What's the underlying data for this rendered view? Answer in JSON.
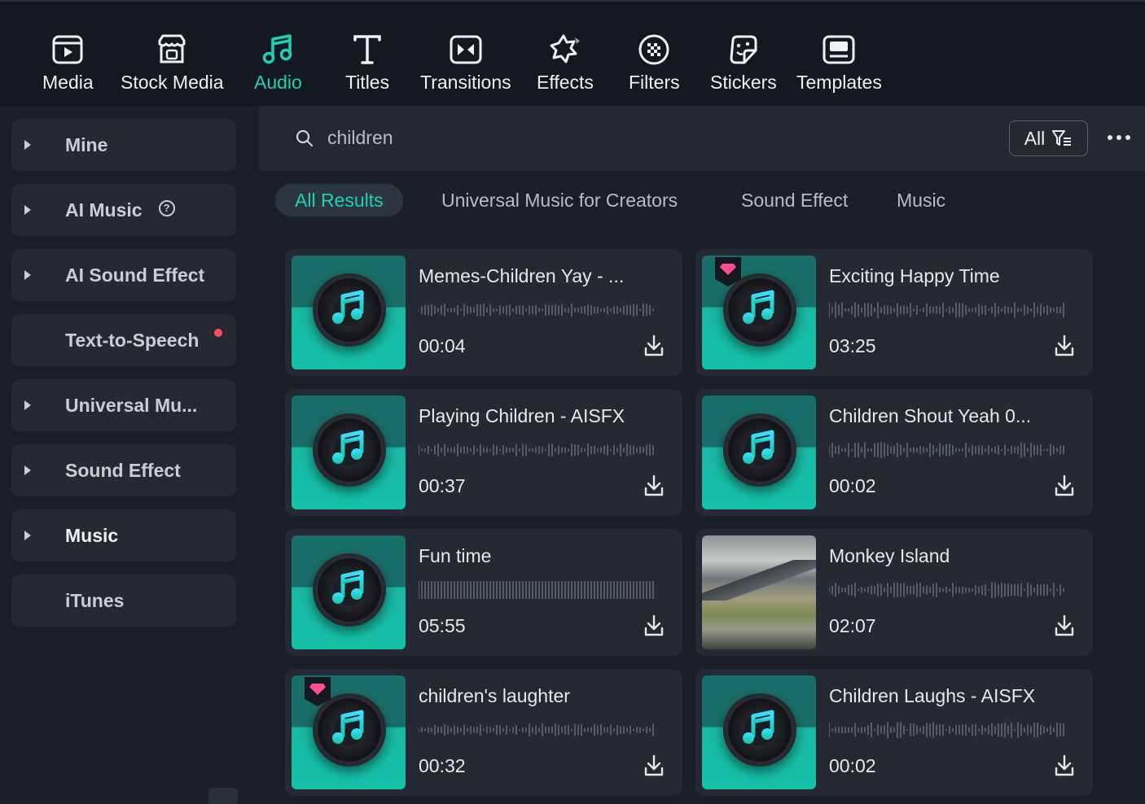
{
  "toolbar": {
    "items": [
      {
        "label": "Media",
        "icon": "media-icon"
      },
      {
        "label": "Stock Media",
        "icon": "stock-media-icon"
      },
      {
        "label": "Audio",
        "icon": "audio-icon",
        "active": true
      },
      {
        "label": "Titles",
        "icon": "titles-icon"
      },
      {
        "label": "Transitions",
        "icon": "transitions-icon"
      },
      {
        "label": "Effects",
        "icon": "effects-icon"
      },
      {
        "label": "Filters",
        "icon": "filters-icon"
      },
      {
        "label": "Stickers",
        "icon": "stickers-icon"
      },
      {
        "label": "Templates",
        "icon": "templates-icon"
      }
    ]
  },
  "sidebar": {
    "items": [
      {
        "label": "Mine"
      },
      {
        "label": "AI Music",
        "help": "?"
      },
      {
        "label": "AI Sound Effect"
      },
      {
        "label": "Text-to-Speech"
      },
      {
        "label": "Universal Mu..."
      },
      {
        "label": "Sound Effect"
      },
      {
        "label": "Music"
      },
      {
        "label": "iTunes"
      }
    ]
  },
  "search": {
    "query": "children",
    "filter_label": "All"
  },
  "tabs": [
    {
      "label": "All Results",
      "active": true
    },
    {
      "label": "Universal Music for Creators"
    },
    {
      "label": "Sound Effect"
    },
    {
      "label": "Music"
    }
  ],
  "results": [
    {
      "title": "Memes-Children Yay - ...",
      "duration": "00:04",
      "premium": false,
      "thumb": "music-disc"
    },
    {
      "title": "Exciting Happy Time",
      "duration": "03:25",
      "premium": true,
      "thumb": "music-disc"
    },
    {
      "title": "Playing Children - AISFX",
      "duration": "00:37",
      "premium": false,
      "thumb": "music-disc"
    },
    {
      "title": "Children Shout Yeah 0...",
      "duration": "00:02",
      "premium": false,
      "thumb": "music-disc"
    },
    {
      "title": "Fun time",
      "duration": "05:55",
      "premium": false,
      "thumb": "music-disc"
    },
    {
      "title": "Monkey Island",
      "duration": "02:07",
      "premium": false,
      "thumb": "landscape"
    },
    {
      "title": "children's laughter",
      "duration": "00:32",
      "premium": true,
      "thumb": "music-disc"
    },
    {
      "title": "Children Laughs - AISFX",
      "duration": "00:02",
      "premium": false,
      "thumb": "music-disc"
    }
  ],
  "colors": {
    "accent": "#1fd1b3",
    "background": "#1b1f27",
    "card": "#242933",
    "premium": "#ff4d8f",
    "notification": "#ff4d5b"
  }
}
